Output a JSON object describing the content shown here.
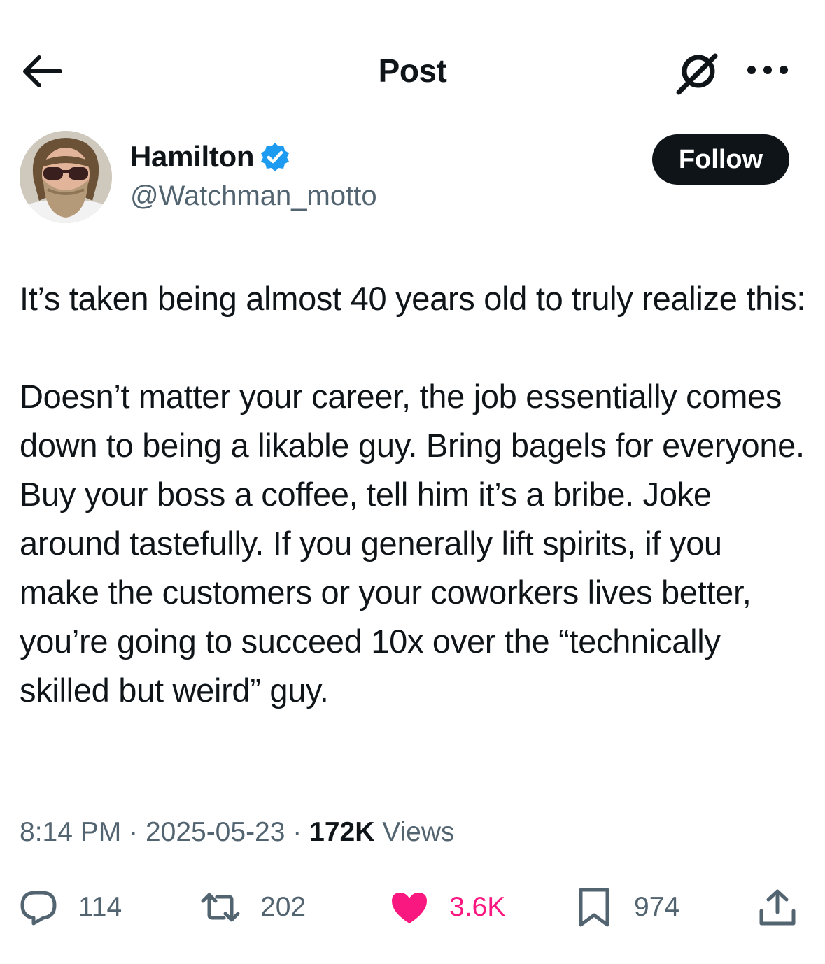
{
  "header": {
    "title": "Post"
  },
  "icons": {
    "back": "arrow-left-icon",
    "grok": "grok-icon",
    "more": "more-horizontal-icon",
    "verified": "verified-badge-icon",
    "reply": "reply-icon",
    "repost": "repost-icon",
    "like": "heart-icon",
    "bookmark": "bookmark-icon",
    "share": "share-icon"
  },
  "author": {
    "name": "Hamilton",
    "handle": "@Watchman_motto",
    "follow_label": "Follow"
  },
  "post": {
    "paragraphs": [
      "It’s taken being almost 40 years old to truly realize this:",
      "Doesn’t matter your career, the job essentially comes down to being a likable guy. Bring bagels for everyone. Buy your boss a coffee, tell him it’s a bribe. Joke around tastefully. If you generally lift spirits, if you make the customers or your coworkers lives better, you’re going to succeed 10x over the “technically skilled but weird” guy."
    ],
    "time": "8:14 PM",
    "date": "2025-05-23",
    "separator": "·",
    "views_count": "172K",
    "views_label": "Views"
  },
  "actions": {
    "replies": "114",
    "reposts": "202",
    "likes": "3.6K",
    "bookmarks": "974"
  },
  "colors": {
    "text": "#0f1419",
    "secondary": "#536471",
    "like": "#f91880",
    "verified": "#1d9bf0",
    "follow_bg": "#0f1419"
  }
}
